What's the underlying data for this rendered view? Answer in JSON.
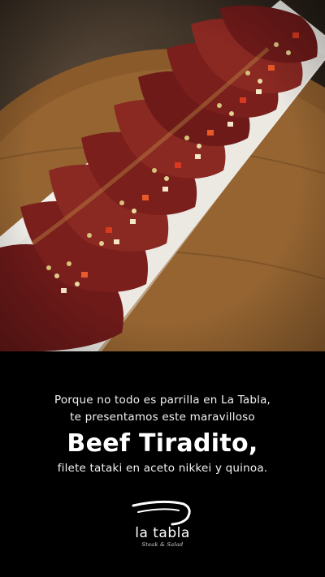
{
  "caption": {
    "line1": "Porque no todo es parrilla en La Tabla,",
    "line2": "te presentamos este maravilloso",
    "dish_name": "Beef Tiradito,",
    "description": "filete tataki en aceto nikkei y quinoa."
  },
  "logo": {
    "name": "la tabla",
    "tagline": "Steak & Salad"
  },
  "colors": {
    "background": "#000000",
    "text": "#ffffff",
    "beef": "#7a1f1c",
    "plate": "#f3f1ec",
    "board": "#8a5a2b"
  }
}
